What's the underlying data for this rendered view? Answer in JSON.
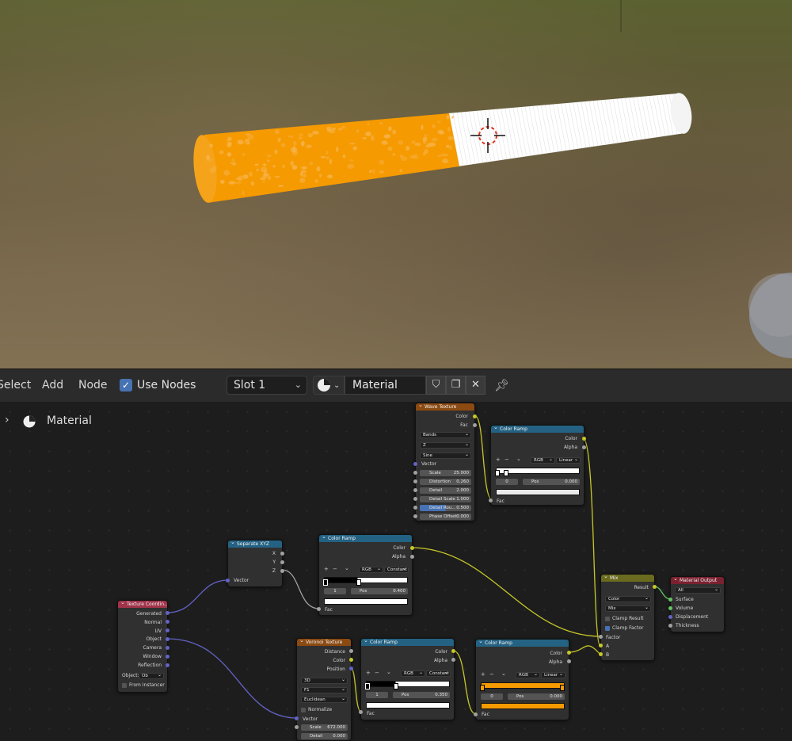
{
  "header": {
    "menus": [
      "Select",
      "Add",
      "Node"
    ],
    "use_nodes_label": "Use Nodes",
    "slot": "Slot 1",
    "material_name": "Material"
  },
  "breadcrumb": {
    "label": "Material"
  },
  "nodes": {
    "wave": {
      "title": "Wave Texture",
      "out_color": "Color",
      "out_fac": "Fac",
      "type": "Bands",
      "direction": "Z",
      "profile": "Sine",
      "in_vector": "Vector",
      "fields": [
        {
          "label": "Scale",
          "value": "25.000"
        },
        {
          "label": "Distortion",
          "value": "0.260"
        },
        {
          "label": "Detail",
          "value": "2.000"
        },
        {
          "label": "Detail Scale",
          "value": "1.000"
        },
        {
          "label": "Detail Rou...",
          "value": "0.500"
        },
        {
          "label": "Phase Offset",
          "value": "0.000"
        }
      ]
    },
    "ramp_top": {
      "title": "Color Ramp",
      "out_color": "Color",
      "out_alpha": "Alpha",
      "mode": "RGB",
      "interp": "Linear",
      "index": "0",
      "pos_label": "Pos",
      "pos": "0.000",
      "in_fac": "Fac"
    },
    "separate": {
      "title": "Separate XYZ",
      "x": "X",
      "y": "Y",
      "z": "Z",
      "in_vector": "Vector"
    },
    "ramp_mid": {
      "title": "Color Ramp",
      "out_color": "Color",
      "out_alpha": "Alpha",
      "mode": "RGB",
      "interp": "Constant",
      "index": "1",
      "pos_label": "Pos",
      "pos": "0.400",
      "in_fac": "Fac"
    },
    "texcoord": {
      "title": "Texture Coordin...",
      "outputs": [
        "Generated",
        "Normal",
        "UV",
        "Object",
        "Camera",
        "Window",
        "Reflection"
      ],
      "object_label": "Object:",
      "object_value": "Ob",
      "from_instancer": "From Instancer"
    },
    "voronoi": {
      "title": "Voronoi Texture",
      "out_distance": "Distance",
      "out_color": "Color",
      "out_position": "Position",
      "dims": "3D",
      "feature": "F1",
      "metric": "Euclidean",
      "normalize": "Normalize",
      "in_vector": "Vector",
      "scale_label": "Scale",
      "scale": "672.000",
      "detail_label": "Detail",
      "detail": "0.000"
    },
    "ramp_low1": {
      "title": "Color Ramp",
      "out_color": "Color",
      "out_alpha": "Alpha",
      "mode": "RGB",
      "interp": "Constant",
      "index": "1",
      "pos_label": "Pos",
      "pos": "0.350",
      "in_fac": "Fac"
    },
    "ramp_low2": {
      "title": "Color Ramp",
      "out_color": "Color",
      "out_alpha": "Alpha",
      "mode": "RGB",
      "interp": "Linear",
      "index": "0",
      "pos_label": "Pos",
      "pos": "0.000",
      "in_fac": "Fac"
    },
    "mix": {
      "title": "Mix",
      "out_result": "Result",
      "data_type": "Color",
      "blend": "Mix",
      "clamp_result": "Clamp Result",
      "clamp_factor": "Clamp Factor",
      "in_factor": "Factor",
      "in_a": "A",
      "in_b": "B"
    },
    "output": {
      "title": "Material Output",
      "target": "All",
      "inputs": [
        "Surface",
        "Volume",
        "Displacement",
        "Thickness"
      ]
    }
  },
  "colors": {
    "accent": "#4772b3",
    "filter": "#f59a00",
    "paper": "#ffffff",
    "wire_color": "#c7c729",
    "wire_vector": "#6363c7"
  }
}
